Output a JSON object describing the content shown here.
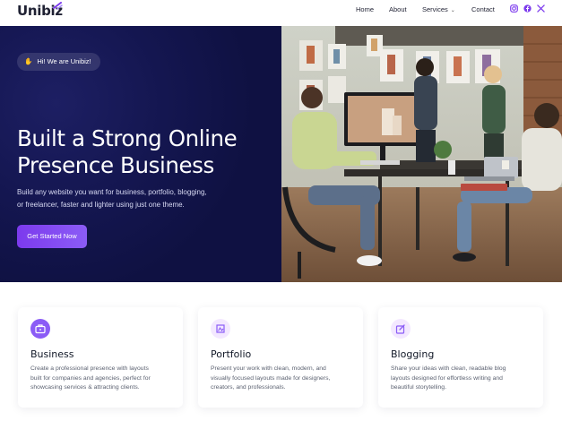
{
  "header": {
    "logo_text": "Unibiz",
    "nav": [
      {
        "label": "Home"
      },
      {
        "label": "About"
      },
      {
        "label": "Services"
      },
      {
        "label": "Contact"
      }
    ],
    "social": [
      "instagram-icon",
      "facebook-icon",
      "x-twitter-icon"
    ],
    "accent_color": "#7c3aed"
  },
  "hero": {
    "badge_icon": "waving-hand-icon",
    "badge_text": "Hi! We are Unibiz!",
    "title_line1": "Built a Strong Online",
    "title_line2": "Presence Business",
    "description_line1": "Build any website you want for business, portfolio, blogging,",
    "description_line2": "or freelancer, faster and lighter using just one theme.",
    "cta_label": "Get Started Now",
    "background_color": "#141650"
  },
  "cards": [
    {
      "icon": "briefcase-icon",
      "title": "Business",
      "desc_line1": "Create a professional presence with layouts",
      "desc_line2": "built for companies and agencies, perfect for",
      "desc_line3": "showcasing services & attracting clients."
    },
    {
      "icon": "portfolio-icon",
      "title": "Portfolio",
      "desc_line1": "Present your work with clean, modern, and",
      "desc_line2": "visually focused layouts made for designers,",
      "desc_line3": "creators, and professionals."
    },
    {
      "icon": "edit-icon",
      "title": "Blogging",
      "desc_line1": "Share your ideas with clean, readable blog",
      "desc_line2": "layouts designed for effortless writing and",
      "desc_line3": "beautiful storytelling."
    }
  ]
}
